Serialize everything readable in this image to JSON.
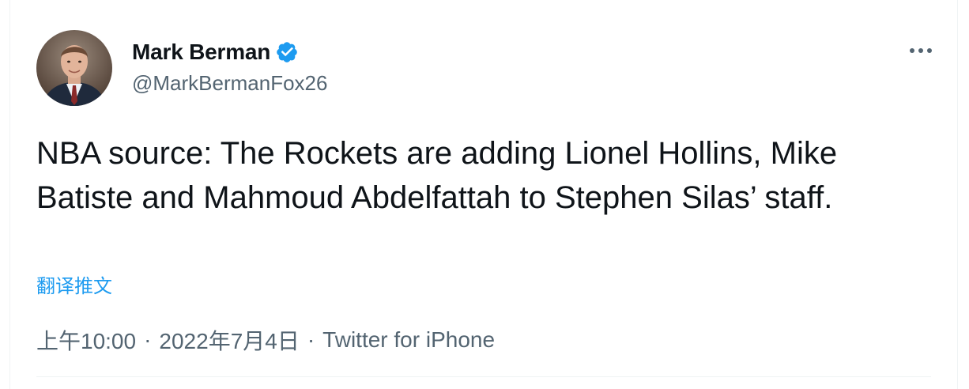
{
  "author": {
    "name": "Mark Berman",
    "handle": "@MarkBermanFox26",
    "verified": true
  },
  "tweet": {
    "text": "NBA source: The Rockets are adding Lionel Hollins, Mike Batiste and Mahmoud Abdelfattah to Stephen Silas’ staff.",
    "translate_label": "翻译推文"
  },
  "meta": {
    "time": "上午10:00",
    "separator": "·",
    "date": "2022年7月4日",
    "source": "Twitter for iPhone"
  },
  "colors": {
    "accent": "#1d9bf0",
    "secondary_text": "#536471",
    "primary_text": "#0f1419",
    "border": "#eff3f4"
  },
  "icons": {
    "verified": "verified-badge-icon",
    "more": "more-options-icon"
  }
}
